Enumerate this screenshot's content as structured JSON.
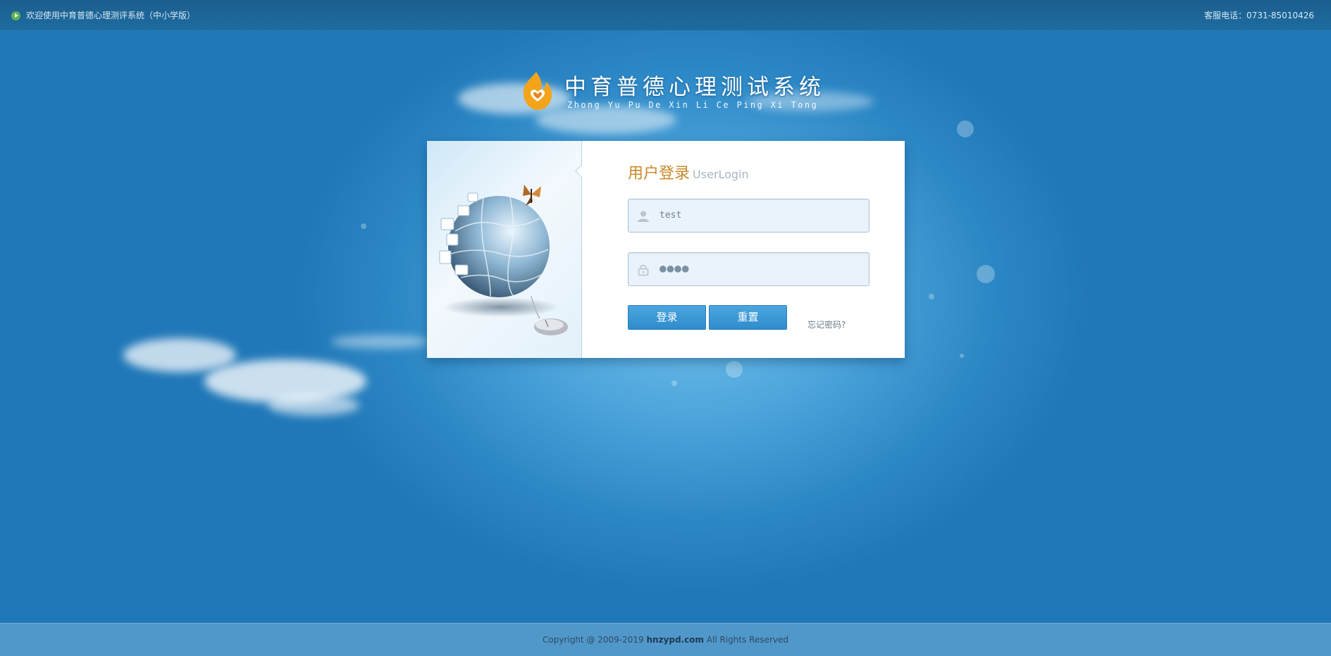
{
  "topbar": {
    "welcome": "欢迎使用中育普德心理测评系统（中小学版）",
    "hotline": "客服电话：0731-85010426",
    "play_icon": "play-icon"
  },
  "logo": {
    "title": "中育普德心理测试系统",
    "subtitle": "Zhong Yu Pu De Xin Li Ce Ping Xi Tong"
  },
  "login": {
    "title": "用户登录",
    "title_en": "UserLogin",
    "username_value": "test",
    "password_mask": "●●●●",
    "login_button": "登录",
    "reset_button": "重置",
    "forgot_link": "忘记密码?"
  },
  "footer": {
    "prefix": "Copyright @ 2009-2019 ",
    "site": "hnzypd.com",
    "suffix": " All Rights Reserved"
  },
  "colors": {
    "brand_orange": "#c9892a",
    "button_blue": "#3a96d4",
    "background_blue": "#2178b8"
  }
}
